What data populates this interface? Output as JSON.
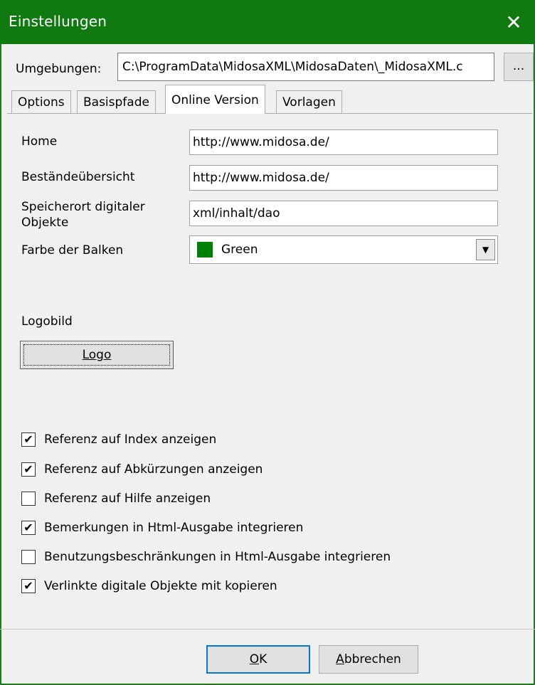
{
  "window": {
    "title": "Einstellungen",
    "close_glyph": "✕"
  },
  "environment": {
    "label": "Umgebungen:",
    "value": "C:\\ProgramData\\MidosaXML\\MidosaDaten\\_MidosaXML.c",
    "browse_label": "..."
  },
  "tabs": [
    {
      "label": "Options",
      "active": false
    },
    {
      "label": "Basispfade",
      "active": false
    },
    {
      "label": "Online Version",
      "active": true
    },
    {
      "label": "Vorlagen",
      "active": false
    }
  ],
  "form": {
    "home_label": "Home",
    "home_value": "http://www.midosa.de/",
    "bestand_label": "Beständeübersicht",
    "bestand_value": "http://www.midosa.de/",
    "speicher_label_1": "Speicherort digitaler",
    "speicher_label_2": "Objekte",
    "speicher_value": "xml/inhalt/dao",
    "farbe_label": "Farbe der Balken",
    "farbe_value": "Green",
    "farbe_swatch": "#008000",
    "logobild_label": "Logobild",
    "logo_button": "Logo"
  },
  "checkboxes": [
    {
      "label": "Referenz auf Index anzeigen",
      "checked": true
    },
    {
      "label": "Referenz auf Abkürzungen anzeigen",
      "checked": true
    },
    {
      "label": "Referenz auf Hilfe anzeigen",
      "checked": false
    },
    {
      "label": "Bemerkungen in Html-Ausgabe integrieren",
      "checked": true
    },
    {
      "label": "Benutzungsbeschränkungen in Html-Ausgabe integrieren",
      "checked": false
    },
    {
      "label": "Verlinkte digitale Objekte mit kopieren",
      "checked": true
    }
  ],
  "buttons": {
    "ok_first": "O",
    "ok_rest": "K",
    "cancel_first": "A",
    "cancel_rest": "bbrechen"
  },
  "check_glyph": "✔",
  "colors": {
    "titlebar": "#0f7a0f",
    "ok_border": "#0078d7"
  }
}
